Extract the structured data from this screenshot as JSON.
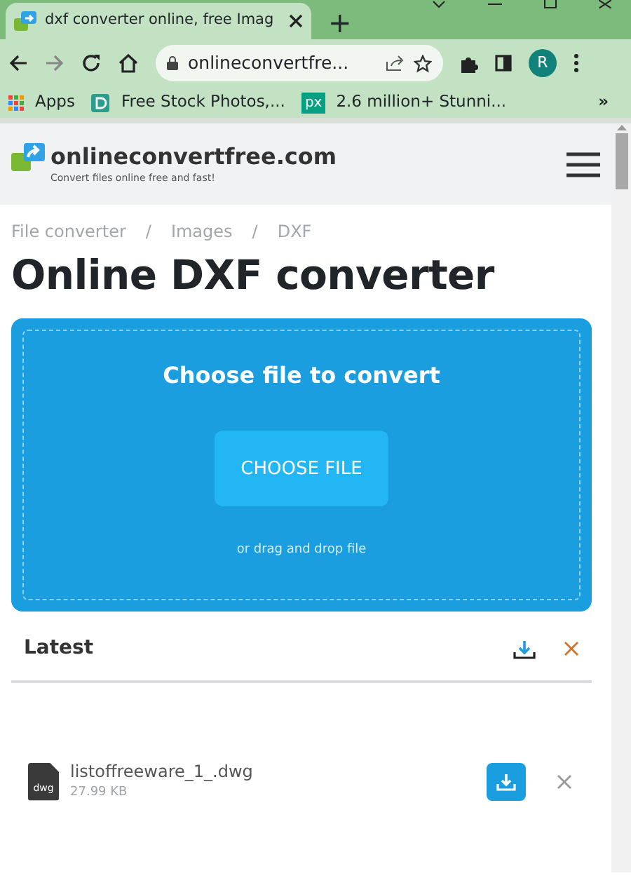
{
  "browser": {
    "tab_title": "dxf converter online, free Imag",
    "new_tab": "+",
    "address": "onlineconvertfre...",
    "avatar": "R",
    "bookmarks": [
      {
        "kind": "apps",
        "label": "Apps"
      },
      {
        "kind": "d",
        "label": "Free Stock Photos,..."
      },
      {
        "kind": "px",
        "label": "2.6 million+ Stunni...",
        "badge": "px"
      }
    ],
    "more": "»"
  },
  "site": {
    "logo": "onlineconvertfree.com",
    "tagline": "Convert files online free and fast!"
  },
  "breadcrumb": [
    {
      "label": "File converter"
    },
    {
      "separator": "/",
      "label": "Images"
    },
    {
      "separator": "/",
      "label": "DXF"
    }
  ],
  "title": "Online DXF converter",
  "dropzone": {
    "heading": "Choose file to convert",
    "button": "CHOOSE FILE",
    "hint": "or drag and drop file"
  },
  "latest": {
    "heading": "Latest",
    "files": [
      {
        "name": "listoffreeware_1_.dwg",
        "size": "27.99 KB",
        "badge": "dwg"
      }
    ]
  }
}
